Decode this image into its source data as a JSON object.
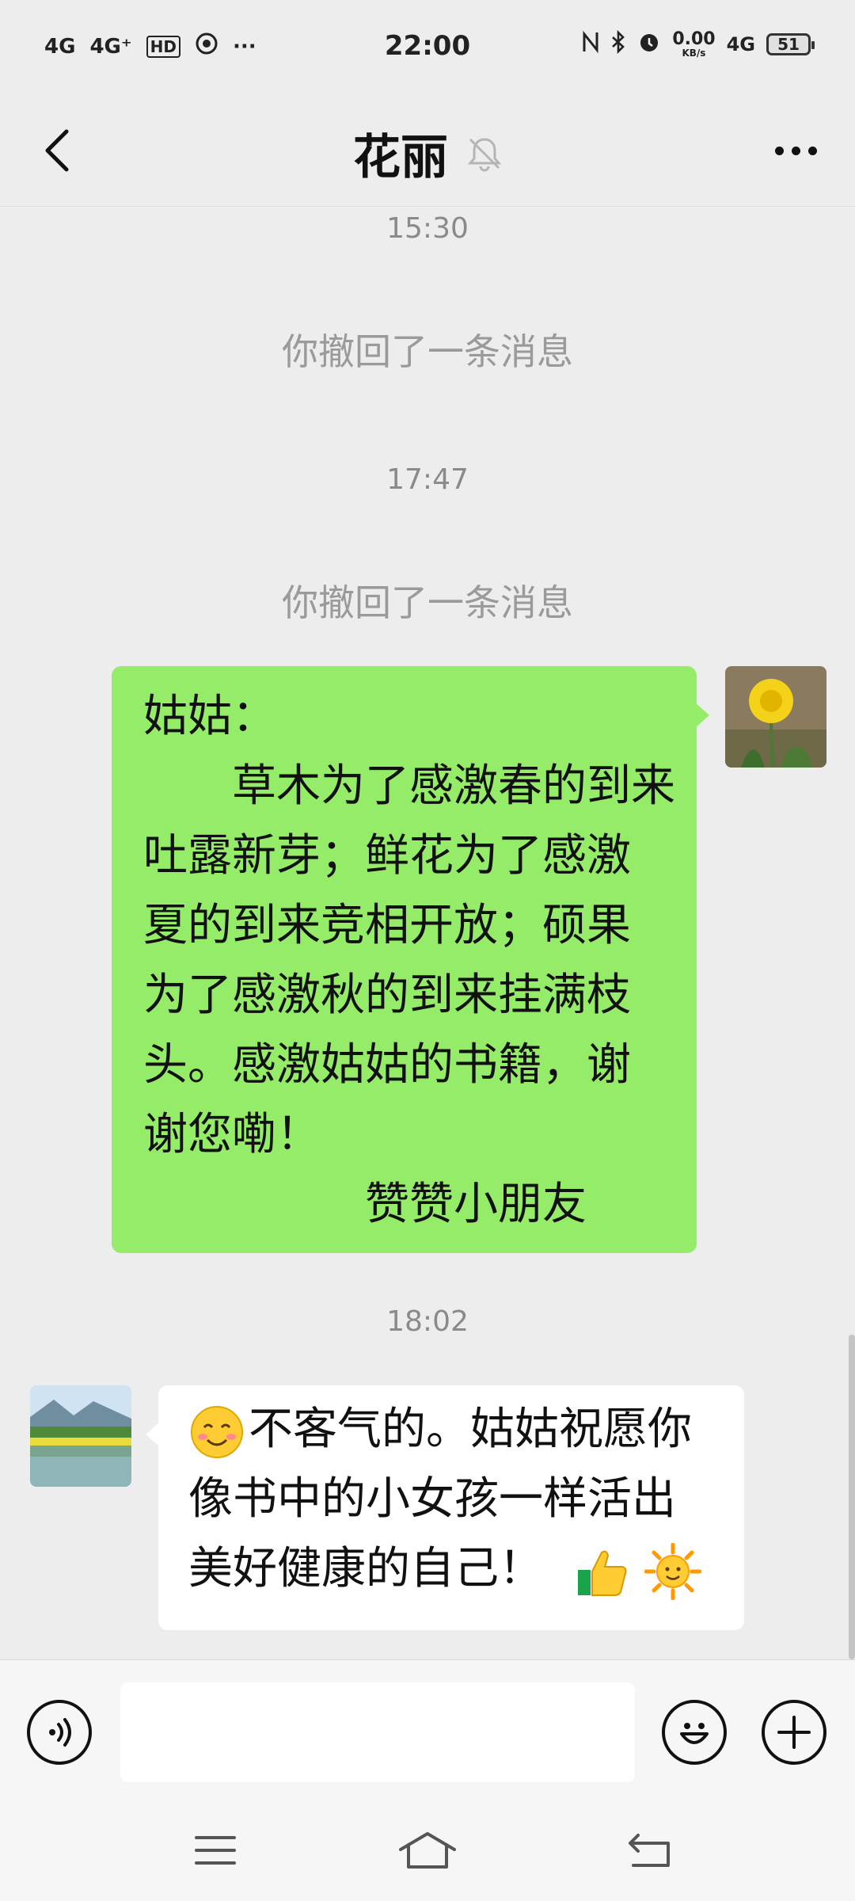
{
  "status_bar": {
    "network_1": "4G",
    "network_2": "4G⁺",
    "hd": "HD",
    "more": "···",
    "time": "22:00",
    "speed_value": "0.00",
    "speed_unit": "KB/s",
    "network_3": "4G",
    "battery": "51"
  },
  "header": {
    "title": "花丽",
    "muted": true
  },
  "messages": {
    "t1": "15:30",
    "recall1": "你撤回了一条消息",
    "t2": "17:47",
    "recall2": "你撤回了一条消息",
    "out_lines": [
      "姑姑：",
      "　　草木为了感激春的到来",
      "吐露新芽；鲜花为了感激",
      "夏的到来竞相开放；硕果",
      "为了感激秋的到来挂满枝",
      "头。感激姑姑的书籍，谢",
      "谢您嘞！",
      "　　　　　赞赞小朋友"
    ],
    "t3": "18:02",
    "in_lines": [
      "不客气的。姑姑祝愿你",
      "像书中的小女孩一样活出",
      "美好健康的自己！"
    ]
  },
  "input": {
    "placeholder": ""
  },
  "icons": {
    "back": "chevron-left-icon",
    "mute": "bell-off-icon",
    "more": "more-dots-icon",
    "voice": "voice-icon",
    "emoji": "emoji-icon",
    "add": "plus-icon",
    "menu": "menu-icon",
    "home": "home-icon",
    "nav_back": "back-arrow-icon"
  },
  "colors": {
    "out_bubble": "#95ec69",
    "in_bubble": "#ffffff",
    "background": "#ededed"
  }
}
